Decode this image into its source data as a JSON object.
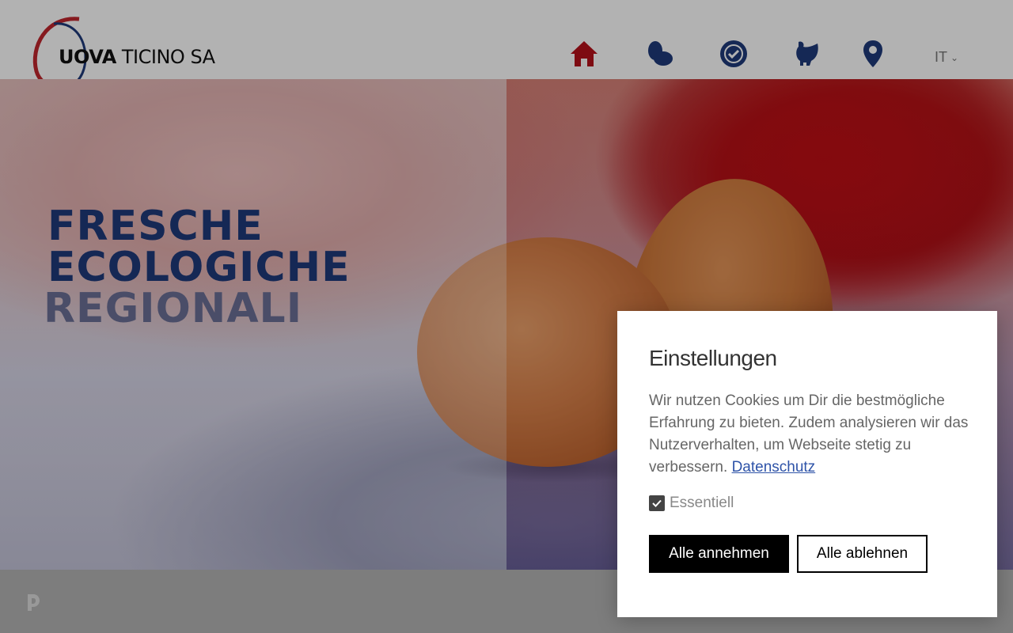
{
  "header": {
    "logo": {
      "brand_bold": "UOVA",
      "brand_rest": " TICINO SA"
    },
    "nav_icons": [
      "home-icon",
      "eggs-icon",
      "quality-badge-icon",
      "hen-icon",
      "location-pin-icon"
    ],
    "language": "IT",
    "colors": {
      "active": "#b5101a",
      "nav": "#1f3a7a"
    }
  },
  "hero": {
    "lines": [
      "FRESCHE",
      "ECOLOGICHE",
      "REGIONALI"
    ],
    "colors": {
      "primary": "#1f3a7a",
      "muted": "#6b6f95"
    }
  },
  "cookie_dialog": {
    "title": "Einstellungen",
    "text": "Wir nutzen Cookies um Dir die bestmögliche Erfahrung zu bieten. Zudem analysieren wir das Nutzerverhalten, um Webseite stetig zu verbessern.",
    "link": "Datenschutz",
    "checkbox_label": "Essentiell",
    "checkbox_checked": true,
    "accept_label": "Alle annehmen",
    "reject_label": "Alle ablehnen"
  }
}
